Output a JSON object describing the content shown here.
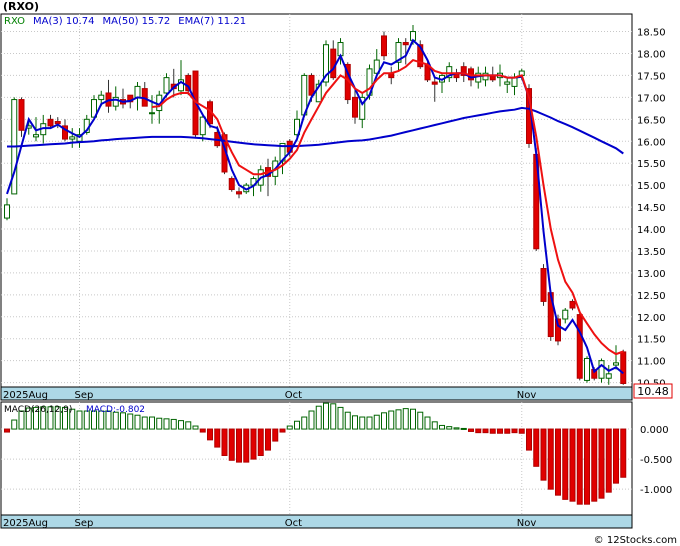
{
  "chart_data": [
    {
      "type": "candlestick",
      "title": "(RXO)",
      "legend": [
        {
          "name": "RXO",
          "value": "",
          "color": "#008000"
        },
        {
          "name": "MA(3)",
          "value": "10.74",
          "color": "#0000cc"
        },
        {
          "name": "MA(50)",
          "value": "15.72",
          "color": "#0000cc"
        },
        {
          "name": "EMA(7)",
          "value": "11.21",
          "color": "#0000cc"
        }
      ],
      "last_price_label": "10.48",
      "ylim": [
        10.4,
        18.9
      ],
      "y_ticks": [
        "10.50",
        "11.00",
        "11.50",
        "12.00",
        "12.50",
        "13.00",
        "13.50",
        "14.00",
        "14.50",
        "15.00",
        "15.50",
        "16.00",
        "16.50",
        "17.00",
        "17.50",
        "18.00",
        "18.50"
      ],
      "x_ticks": [
        {
          "label": "2025Aug",
          "i": 0
        },
        {
          "label": "Sep",
          "i": 10
        },
        {
          "label": "Oct",
          "i": 39
        },
        {
          "label": "Nov",
          "i": 71
        }
      ],
      "candles": [
        [
          14.25,
          14.7,
          14.2,
          14.55
        ],
        [
          14.8,
          17.0,
          14.8,
          16.95
        ],
        [
          16.95,
          17.0,
          16.1,
          16.25
        ],
        [
          16.3,
          16.5,
          16.15,
          16.35
        ],
        [
          16.1,
          16.55,
          16.0,
          16.15
        ],
        [
          16.15,
          16.6,
          15.95,
          16.4
        ],
        [
          16.5,
          16.6,
          16.3,
          16.35
        ],
        [
          16.45,
          16.55,
          16.3,
          16.4
        ],
        [
          16.35,
          16.5,
          16.0,
          16.05
        ],
        [
          16.05,
          16.3,
          15.85,
          16.1
        ],
        [
          16.0,
          16.3,
          15.85,
          16.15
        ],
        [
          16.2,
          16.6,
          16.15,
          16.5
        ],
        [
          16.55,
          17.05,
          16.5,
          16.95
        ],
        [
          16.95,
          17.15,
          16.8,
          17.05
        ],
        [
          17.1,
          17.4,
          16.65,
          16.8
        ],
        [
          16.8,
          17.25,
          16.7,
          17.0
        ],
        [
          16.95,
          17.2,
          16.75,
          16.85
        ],
        [
          17.05,
          17.05,
          16.75,
          16.9
        ],
        [
          17.0,
          17.35,
          16.7,
          17.25
        ],
        [
          17.2,
          17.35,
          16.85,
          16.8
        ],
        [
          16.65,
          17.05,
          16.4,
          16.65
        ],
        [
          16.7,
          17.15,
          16.4,
          17.05
        ],
        [
          17.1,
          17.55,
          17.0,
          17.45
        ],
        [
          17.3,
          17.65,
          17.0,
          17.2
        ],
        [
          17.15,
          17.85,
          17.05,
          17.4
        ],
        [
          17.5,
          17.55,
          17.05,
          17.15
        ],
        [
          17.6,
          17.6,
          16.1,
          16.15
        ],
        [
          16.15,
          16.6,
          16.0,
          16.55
        ],
        [
          16.9,
          16.95,
          16.3,
          16.4
        ],
        [
          16.2,
          16.35,
          15.85,
          15.9
        ],
        [
          16.15,
          16.2,
          15.25,
          15.3
        ],
        [
          15.15,
          15.2,
          14.85,
          14.9
        ],
        [
          14.85,
          14.95,
          14.7,
          14.8
        ],
        [
          14.85,
          15.05,
          14.8,
          15.0
        ],
        [
          15.0,
          15.2,
          14.75,
          15.15
        ],
        [
          15.0,
          15.45,
          14.85,
          15.35
        ],
        [
          15.4,
          15.6,
          14.75,
          15.2
        ],
        [
          15.2,
          15.65,
          15.0,
          15.55
        ],
        [
          15.55,
          15.95,
          15.25,
          15.95
        ],
        [
          16.0,
          16.05,
          15.65,
          15.75
        ],
        [
          16.15,
          16.7,
          16.0,
          16.5
        ],
        [
          16.6,
          17.55,
          16.55,
          17.5
        ],
        [
          17.5,
          17.55,
          16.9,
          17.05
        ],
        [
          16.9,
          17.4,
          16.9,
          17.3
        ],
        [
          17.35,
          18.3,
          17.25,
          18.2
        ],
        [
          18.1,
          18.3,
          17.4,
          17.45
        ],
        [
          17.95,
          18.35,
          17.75,
          18.25
        ],
        [
          17.75,
          17.8,
          16.85,
          16.95
        ],
        [
          17.0,
          17.2,
          16.4,
          16.55
        ],
        [
          16.5,
          17.1,
          16.3,
          17.0
        ],
        [
          17.05,
          17.75,
          16.95,
          17.65
        ],
        [
          17.55,
          18.1,
          17.5,
          17.85
        ],
        [
          18.4,
          18.5,
          17.85,
          17.95
        ],
        [
          17.55,
          17.7,
          17.3,
          17.45
        ],
        [
          17.8,
          18.35,
          17.6,
          18.25
        ],
        [
          18.25,
          18.35,
          17.75,
          18.2
        ],
        [
          18.3,
          18.65,
          18.2,
          18.5
        ],
        [
          18.2,
          18.3,
          17.65,
          17.7
        ],
        [
          17.75,
          17.8,
          17.35,
          17.4
        ],
        [
          17.35,
          17.45,
          16.9,
          17.3
        ],
        [
          17.35,
          17.55,
          17.1,
          17.5
        ],
        [
          17.45,
          17.8,
          17.35,
          17.7
        ],
        [
          17.55,
          17.65,
          17.35,
          17.45
        ],
        [
          17.7,
          17.8,
          17.35,
          17.5
        ],
        [
          17.65,
          17.7,
          17.25,
          17.4
        ],
        [
          17.35,
          17.7,
          17.2,
          17.55
        ],
        [
          17.4,
          17.7,
          17.25,
          17.55
        ],
        [
          17.5,
          17.7,
          17.35,
          17.4
        ],
        [
          17.45,
          17.75,
          17.25,
          17.55
        ],
        [
          17.3,
          17.45,
          17.1,
          17.35
        ],
        [
          17.25,
          17.55,
          17.05,
          17.45
        ],
        [
          17.5,
          17.65,
          17.4,
          17.6
        ],
        [
          17.2,
          17.3,
          15.85,
          15.95
        ],
        [
          15.7,
          15.85,
          13.5,
          13.55
        ],
        [
          13.1,
          13.2,
          12.25,
          12.35
        ],
        [
          12.55,
          12.6,
          11.45,
          11.55
        ],
        [
          11.95,
          12.05,
          11.35,
          11.45
        ],
        [
          11.95,
          12.2,
          11.85,
          12.15
        ],
        [
          12.35,
          12.4,
          12.15,
          12.2
        ],
        [
          12.05,
          12.1,
          10.55,
          10.6
        ],
        [
          10.55,
          11.1,
          10.5,
          11.05
        ],
        [
          10.8,
          10.85,
          10.55,
          10.6
        ],
        [
          10.6,
          11.05,
          10.5,
          11.0
        ],
        [
          10.6,
          10.9,
          10.45,
          10.7
        ],
        [
          10.9,
          11.35,
          10.8,
          10.95
        ],
        [
          11.2,
          11.25,
          10.45,
          10.48
        ]
      ],
      "series": [
        {
          "name": "MA(3)",
          "color": "#0000cc",
          "values": [
            14.8,
            15.3,
            15.9,
            16.5,
            16.25,
            16.3,
            16.3,
            16.38,
            16.27,
            16.18,
            16.1,
            16.25,
            16.5,
            16.85,
            16.93,
            16.95,
            16.9,
            16.92,
            17.0,
            16.98,
            16.9,
            16.83,
            17.05,
            17.23,
            17.35,
            17.25,
            16.9,
            16.6,
            16.35,
            16.3,
            15.85,
            15.35,
            15.0,
            14.9,
            14.98,
            15.17,
            15.23,
            15.37,
            15.57,
            15.75,
            16.05,
            16.6,
            17.0,
            17.25,
            17.5,
            17.65,
            17.95,
            17.55,
            17.2,
            16.85,
            17.05,
            17.5,
            17.8,
            17.75,
            17.85,
            17.95,
            18.3,
            18.15,
            17.85,
            17.45,
            17.4,
            17.5,
            17.55,
            17.55,
            17.45,
            17.48,
            17.5,
            17.5,
            17.5,
            17.45,
            17.45,
            17.47,
            17.0,
            15.7,
            13.95,
            12.5,
            11.8,
            11.7,
            11.93,
            11.65,
            11.3,
            10.75,
            10.9,
            10.77,
            10.85,
            10.71
          ]
        },
        {
          "name": "MA(50)",
          "color": "#0000cc",
          "values": [
            15.88,
            15.88,
            15.89,
            15.9,
            15.91,
            15.92,
            15.93,
            15.94,
            15.95,
            15.97,
            15.98,
            15.99,
            16.0,
            16.02,
            16.03,
            16.05,
            16.06,
            16.07,
            16.08,
            16.09,
            16.1,
            16.1,
            16.1,
            16.1,
            16.1,
            16.09,
            16.08,
            16.07,
            16.05,
            16.03,
            16.01,
            15.99,
            15.97,
            15.95,
            15.93,
            15.92,
            15.91,
            15.9,
            15.89,
            15.89,
            15.89,
            15.9,
            15.91,
            15.92,
            15.94,
            15.96,
            15.98,
            16.0,
            16.01,
            16.02,
            16.04,
            16.07,
            16.1,
            16.13,
            16.17,
            16.21,
            16.25,
            16.29,
            16.33,
            16.37,
            16.41,
            16.45,
            16.49,
            16.53,
            16.56,
            16.59,
            16.62,
            16.65,
            16.68,
            16.7,
            16.72,
            16.76,
            16.74,
            16.68,
            16.61,
            16.54,
            16.46,
            16.39,
            16.32,
            16.24,
            16.16,
            16.08,
            16.0,
            15.92,
            15.84,
            15.72
          ]
        },
        {
          "name": "EMA(7)",
          "color": "#ee1111",
          "values": [
            null,
            null,
            null,
            null,
            null,
            null,
            null,
            null,
            null,
            null,
            null,
            null,
            null,
            null,
            null,
            null,
            null,
            null,
            null,
            null,
            16.78,
            16.8,
            16.95,
            17.05,
            17.1,
            17.1,
            16.9,
            16.8,
            16.7,
            16.5,
            16.1,
            15.75,
            15.45,
            15.35,
            15.25,
            15.25,
            15.3,
            15.35,
            15.45,
            15.6,
            15.8,
            16.2,
            16.5,
            16.8,
            17.1,
            17.3,
            17.5,
            17.4,
            17.2,
            17.1,
            17.2,
            17.4,
            17.55,
            17.55,
            17.6,
            17.7,
            17.85,
            17.8,
            17.75,
            17.6,
            17.55,
            17.55,
            17.55,
            17.55,
            17.5,
            17.5,
            17.5,
            17.5,
            17.5,
            17.45,
            17.45,
            17.5,
            17.0,
            16.1,
            15.0,
            14.0,
            13.3,
            12.8,
            12.55,
            12.1,
            11.85,
            11.6,
            11.4,
            11.25,
            11.15,
            11.21
          ]
        }
      ]
    },
    {
      "type": "bar",
      "title": "MACD(26,12,9)",
      "legend_value": "MACD:-0.802",
      "ylim": [
        -1.43,
        0.45
      ],
      "y_ticks": [
        "0.000",
        "-0.500",
        "-1.000"
      ],
      "x_ticks": [
        {
          "label": "2025Aug",
          "i": 0
        },
        {
          "label": "Sep",
          "i": 10
        },
        {
          "label": "Oct",
          "i": 39
        },
        {
          "label": "Nov",
          "i": 71
        }
      ],
      "values": [
        -0.05,
        0.15,
        0.3,
        0.35,
        0.36,
        0.37,
        0.37,
        0.37,
        0.36,
        0.33,
        0.3,
        0.3,
        0.3,
        0.3,
        0.3,
        0.28,
        0.27,
        0.25,
        0.23,
        0.2,
        0.2,
        0.18,
        0.17,
        0.16,
        0.14,
        0.12,
        0.05,
        -0.05,
        -0.18,
        -0.3,
        -0.44,
        -0.52,
        -0.55,
        -0.55,
        -0.5,
        -0.44,
        -0.35,
        -0.2,
        -0.05,
        0.05,
        0.13,
        0.2,
        0.3,
        0.38,
        0.43,
        0.42,
        0.36,
        0.28,
        0.22,
        0.2,
        0.2,
        0.23,
        0.27,
        0.3,
        0.32,
        0.34,
        0.33,
        0.28,
        0.2,
        0.12,
        0.06,
        0.04,
        0.02,
        0.01,
        -0.04,
        -0.06,
        -0.06,
        -0.07,
        -0.07,
        -0.07,
        -0.06,
        -0.07,
        -0.35,
        -0.62,
        -0.85,
        -1.0,
        -1.1,
        -1.17,
        -1.2,
        -1.25,
        -1.25,
        -1.2,
        -1.15,
        -1.05,
        -0.9,
        -0.802
      ]
    }
  ],
  "watermark": "© 12Stocks.com"
}
